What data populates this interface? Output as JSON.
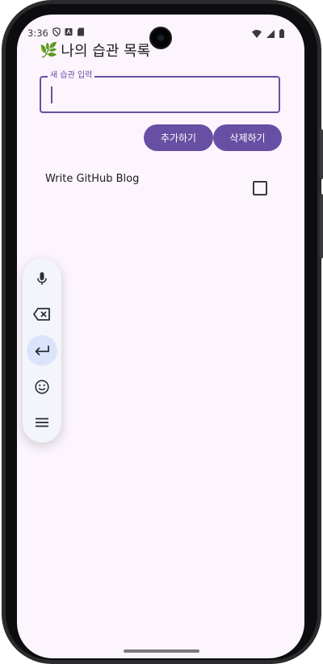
{
  "status_bar": {
    "time": "3:36"
  },
  "app": {
    "title": "나의 습관 목록",
    "title_emoji": "🌿"
  },
  "input": {
    "label": "새 습관 입력",
    "value": ""
  },
  "buttons": {
    "add": "추가하기",
    "delete": "삭제하기"
  },
  "habits": [
    {
      "name": "Write GitHub Blog",
      "checked": false
    }
  ],
  "keyboard_toolbar": {
    "items": [
      "microphone-icon",
      "backspace-icon",
      "enter-icon",
      "emoji-icon",
      "menu-icon"
    ],
    "active": "enter-icon"
  },
  "colors": {
    "primary": "#6750a4",
    "background": "#fcf5fd",
    "toolbar_active": "#dbe4fb"
  }
}
